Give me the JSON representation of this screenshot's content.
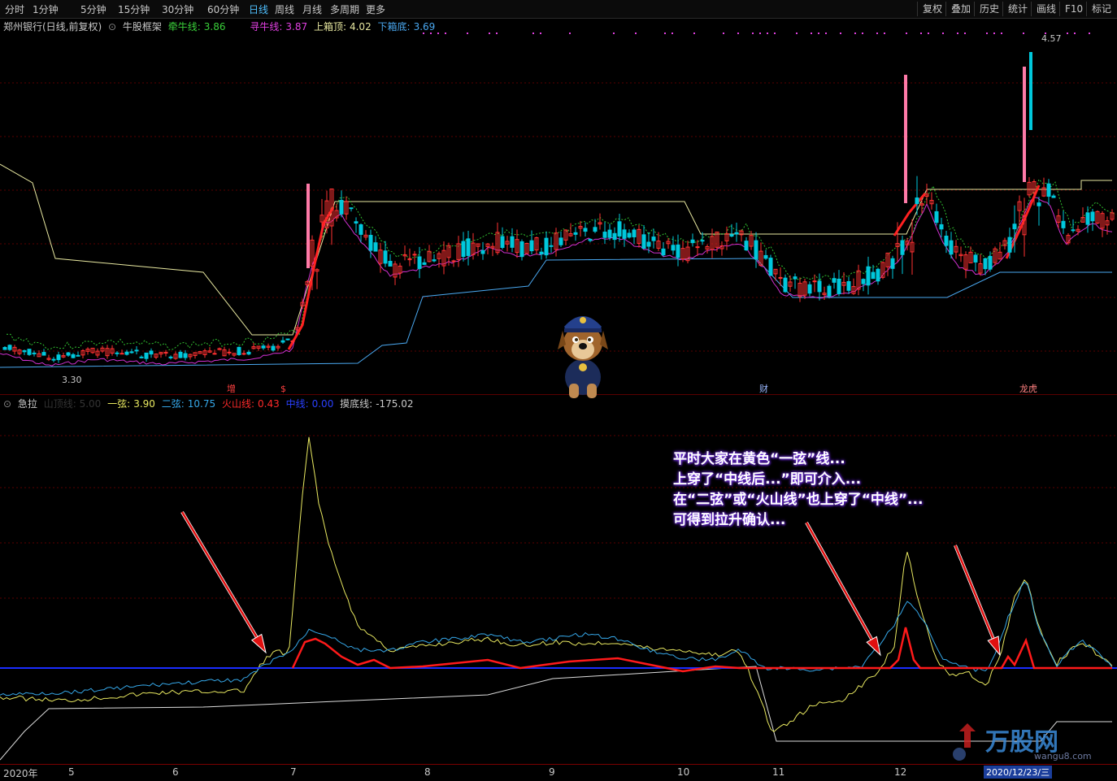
{
  "toolbar": {
    "periods": [
      "分时",
      "1分钟",
      "5分钟",
      "15分钟",
      "30分钟",
      "60分钟",
      "日线",
      "周线",
      "月线",
      "多周期",
      "更多"
    ],
    "active": "日线",
    "right_buttons": [
      "复权",
      "叠加",
      "历史",
      "统计",
      "画线",
      "F10",
      "标记"
    ]
  },
  "main_legend": {
    "stock": "郑州银行(日线,前复权)",
    "indicator": "牛股框架",
    "qianniu": {
      "label": "牵牛线:",
      "value": "3.86"
    },
    "xunniu": {
      "label": "寻牛线:",
      "value": "3.87"
    },
    "upper_box": {
      "label": "上箱顶:",
      "value": "4.02"
    },
    "lower_box": {
      "label": "下箱底:",
      "value": "3.69"
    }
  },
  "sub_legend": {
    "indicator": "急拉",
    "hidden": "山顶线: 5.00",
    "yixian": {
      "label": "一弦:",
      "value": "3.90"
    },
    "erxian": {
      "label": "二弦:",
      "value": "10.75"
    },
    "huoshan": {
      "label": "火山线:",
      "value": "0.43"
    },
    "zhongxian": {
      "label": "中线:",
      "value": "0.00"
    },
    "modi": {
      "label": "摸底线:",
      "value": "-175.02"
    }
  },
  "price_marks": {
    "high": "4.57",
    "low": "3.30"
  },
  "event_marks": [
    "增",
    "$",
    "财",
    "龙虎"
  ],
  "annotation": [
    "平时大家在黄色“一弦”线...",
    "上穿了“中线后...”即可介入...",
    "在“二弦”或“火山线”也上穿了“中线”...",
    "可得到拉升确认..."
  ],
  "date_axis": {
    "labels": [
      "2020年",
      "5",
      "6",
      "7",
      "8",
      "9",
      "10",
      "11",
      "12"
    ],
    "cursor_date": "2020/12/23/三"
  },
  "watermark": {
    "text": "万股网",
    "url": "wangu8.com"
  },
  "colors": {
    "up": "#ff3232",
    "down": "#00c8dc",
    "yixian": "#e8e860",
    "erxian": "#35a7e8",
    "huoshan": "#ff1a1a",
    "zhongxian": "#1a2cff",
    "box_top": "#e8e8a0",
    "box_bottom": "#4aa8f0",
    "qianniu": "#ff2020",
    "xunniu": "#d030d0"
  },
  "chart_data": [
    {
      "type": "candlestick",
      "title": "郑州银行(日线,前复权)",
      "x_range": [
        "2020-04",
        "2020-12"
      ],
      "ylim": [
        3.3,
        4.57
      ],
      "series": [
        {
          "name": "牵牛线",
          "last": 3.86
        },
        {
          "name": "寻牛线",
          "last": 3.87
        },
        {
          "name": "上箱顶",
          "last": 4.02
        },
        {
          "name": "下箱底",
          "last": 3.69
        }
      ]
    },
    {
      "type": "line",
      "title": "急拉",
      "series": [
        {
          "name": "一弦",
          "last": 3.9
        },
        {
          "name": "二弦",
          "last": 10.75
        },
        {
          "name": "火山线",
          "last": 0.43
        },
        {
          "name": "中线",
          "last": 0.0
        },
        {
          "name": "摸底线",
          "last": -175.02
        }
      ]
    }
  ]
}
